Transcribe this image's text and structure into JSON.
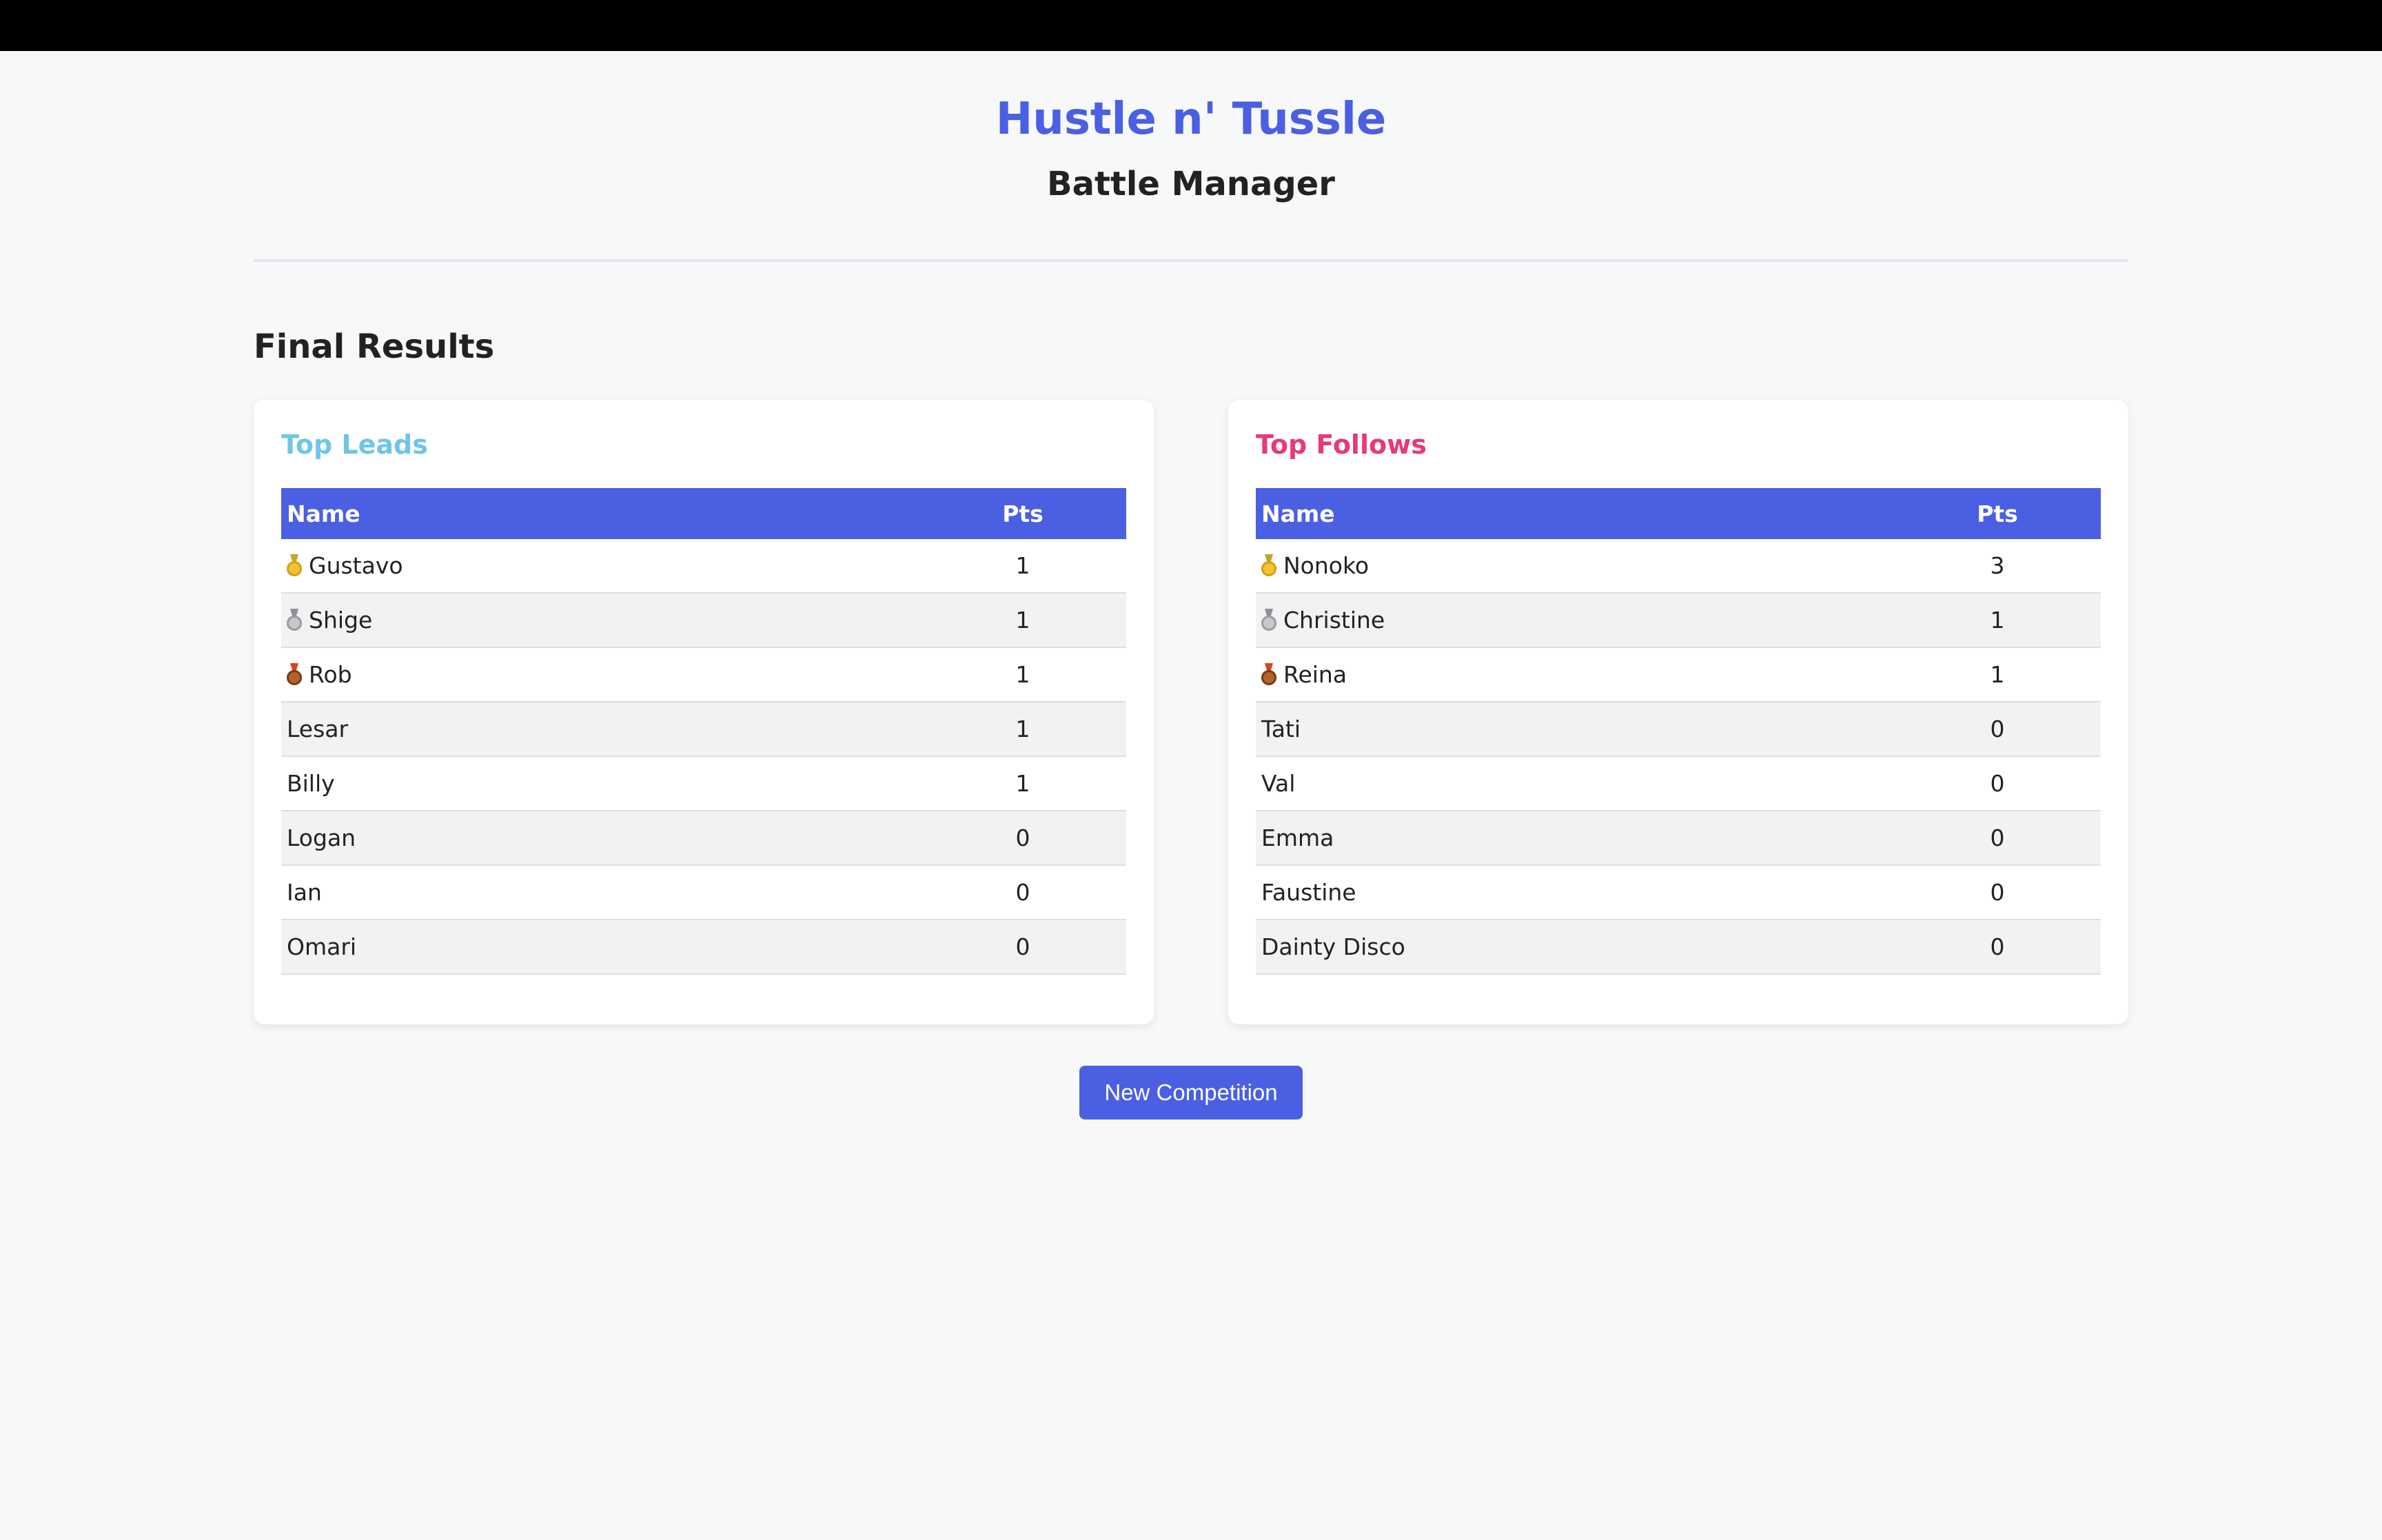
{
  "header": {
    "title": "Hustle n' Tussle",
    "subtitle": "Battle Manager"
  },
  "results": {
    "heading": "Final Results",
    "leads": {
      "title": "Top Leads",
      "columns": [
        "Name",
        "Pts"
      ],
      "rows": [
        {
          "medal": "gold-medal",
          "name": "Gustavo",
          "pts": "1"
        },
        {
          "medal": "silver-medal",
          "name": "Shige",
          "pts": "1"
        },
        {
          "medal": "bronze-medal",
          "name": "Rob",
          "pts": "1"
        },
        {
          "medal": "",
          "name": "Lesar",
          "pts": "1"
        },
        {
          "medal": "",
          "name": "Billy",
          "pts": "1"
        },
        {
          "medal": "",
          "name": "Logan",
          "pts": "0"
        },
        {
          "medal": "",
          "name": "Ian",
          "pts": "0"
        },
        {
          "medal": "",
          "name": "Omari",
          "pts": "0"
        }
      ]
    },
    "follows": {
      "title": "Top Follows",
      "columns": [
        "Name",
        "Pts"
      ],
      "rows": [
        {
          "medal": "gold-medal",
          "name": "Nonoko",
          "pts": "3"
        },
        {
          "medal": "silver-medal",
          "name": "Christine",
          "pts": "1"
        },
        {
          "medal": "bronze-medal",
          "name": "Reina",
          "pts": "1"
        },
        {
          "medal": "",
          "name": "Tati",
          "pts": "0"
        },
        {
          "medal": "",
          "name": "Val",
          "pts": "0"
        },
        {
          "medal": "",
          "name": "Emma",
          "pts": "0"
        },
        {
          "medal": "",
          "name": "Faustine",
          "pts": "0"
        },
        {
          "medal": "",
          "name": "Dainty Disco",
          "pts": "0"
        }
      ]
    }
  },
  "actions": {
    "new_competition_label": "New Competition"
  },
  "colors": {
    "accent": "#4a5fe2",
    "leads_title": "#6ec6e6",
    "follows_title": "#e6397a",
    "background": "#f7f8fa"
  }
}
